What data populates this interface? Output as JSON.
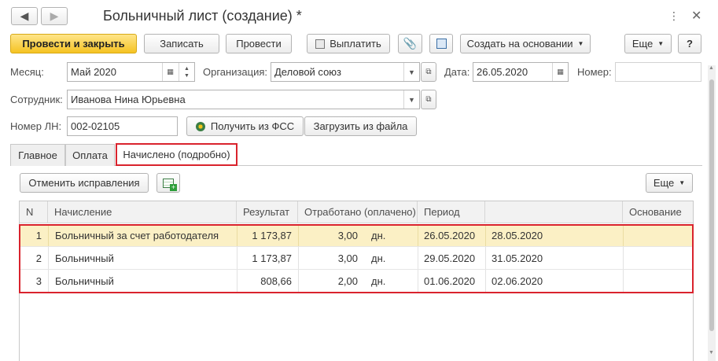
{
  "window": {
    "title": "Больничный лист (создание) *",
    "back_icon": "arrow-left-icon",
    "forward_icon": "arrow-right-icon",
    "more_icon": "vertical-dots-icon",
    "close_icon": "close-icon"
  },
  "toolbar": {
    "post_close_label": "Провести и закрыть",
    "save_label": "Записать",
    "post_label": "Провести",
    "pay_label": "Выплатить",
    "attach_icon": "paperclip-icon",
    "structure_icon": "document-structure-icon",
    "create_based_label": "Создать на основании",
    "more_label": "Еще",
    "help_label": "?"
  },
  "form": {
    "month_label": "Месяц:",
    "month_value": "Май 2020",
    "org_label": "Организация:",
    "org_value": "Деловой союз",
    "date_label": "Дата:",
    "date_value": "26.05.2020",
    "number_label": "Номер:",
    "number_value": "",
    "employee_label": "Сотрудник:",
    "employee_value": "Иванова Нина Юрьевна",
    "ln_label": "Номер ЛН:",
    "ln_value": "002-02105",
    "get_fss_label": "Получить из ФСС",
    "load_file_label": "Загрузить из файла"
  },
  "tabs": [
    {
      "label": "Главное"
    },
    {
      "label": "Оплата"
    },
    {
      "label": "Начислено (подробно)"
    }
  ],
  "grid_toolbar": {
    "cancel_corrections_label": "Отменить исправления",
    "add_icon": "table-add-icon",
    "more_label": "Еще"
  },
  "grid": {
    "columns": [
      "N",
      "Начисление",
      "Результат",
      "Отработано (оплачено)",
      "Период",
      "",
      "Основание"
    ],
    "rows": [
      {
        "n": "1",
        "name": "Больничный за счет работодателя",
        "result": "1 173,87",
        "worked": "3,00",
        "unit": "дн.",
        "from": "26.05.2020",
        "to": "28.05.2020",
        "basis": ""
      },
      {
        "n": "2",
        "name": "Больничный",
        "result": "1 173,87",
        "worked": "3,00",
        "unit": "дн.",
        "from": "29.05.2020",
        "to": "31.05.2020",
        "basis": ""
      },
      {
        "n": "3",
        "name": "Больничный",
        "result": "808,66",
        "worked": "2,00",
        "unit": "дн.",
        "from": "01.06.2020",
        "to": "02.06.2020",
        "basis": ""
      }
    ]
  },
  "colors": {
    "primary_button": "#f5c323",
    "selected_row": "#fbf0c5",
    "highlight_border": "#d9232d"
  }
}
